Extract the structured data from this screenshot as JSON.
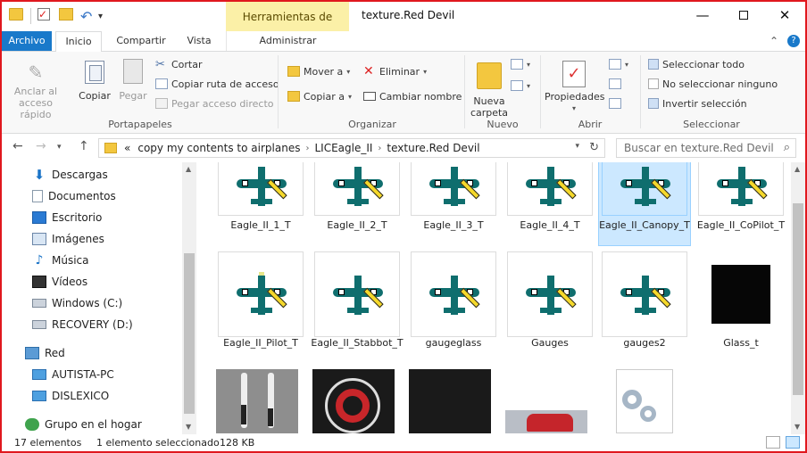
{
  "window": {
    "title": "texture.Red Devil",
    "context_tab": "Herramientas de imagen"
  },
  "tabs": {
    "archivo": "Archivo",
    "inicio": "Inicio",
    "compartir": "Compartir",
    "vista": "Vista",
    "administrar": "Administrar"
  },
  "ribbon": {
    "portapapeles": {
      "label": "Portapapeles",
      "anclar": "Anclar al acceso rápido",
      "copiar": "Copiar",
      "pegar": "Pegar",
      "cortar": "Cortar",
      "copiar_ruta": "Copiar ruta de acceso",
      "pegar_acceso": "Pegar acceso directo"
    },
    "organizar": {
      "label": "Organizar",
      "mover": "Mover a",
      "copiar_a": "Copiar a",
      "eliminar": "Eliminar",
      "cambiar_nombre": "Cambiar nombre"
    },
    "nuevo": {
      "label": "Nuevo",
      "nueva_carpeta": "Nueva carpeta"
    },
    "abrir": {
      "label": "Abrir",
      "propiedades": "Propiedades"
    },
    "seleccionar": {
      "label": "Seleccionar",
      "todo": "Seleccionar todo",
      "ninguno": "No seleccionar ninguno",
      "invertir": "Invertir selección"
    }
  },
  "address": {
    "prefix": "«",
    "crumbs": [
      "copy my contents to airplanes",
      "LICEagle_II",
      "texture.Red Devil"
    ],
    "search_placeholder": "Buscar en texture.Red Devil"
  },
  "navpane": {
    "items": [
      {
        "label": "Descargas",
        "icon": "download-icon"
      },
      {
        "label": "Documentos",
        "icon": "documents-icon"
      },
      {
        "label": "Escritorio",
        "icon": "desktop-icon"
      },
      {
        "label": "Imágenes",
        "icon": "pictures-icon"
      },
      {
        "label": "Música",
        "icon": "music-icon"
      },
      {
        "label": "Vídeos",
        "icon": "videos-icon"
      },
      {
        "label": "Windows (C:)",
        "icon": "drive-icon"
      },
      {
        "label": "RECOVERY (D:)",
        "icon": "drive-icon"
      },
      {
        "label": "Red",
        "icon": "network-icon"
      },
      {
        "label": "AUTISTA-PC",
        "icon": "computer-icon"
      },
      {
        "label": "DISLEXICO",
        "icon": "computer-icon"
      },
      {
        "label": "Grupo en el hogar",
        "icon": "homegroup-icon"
      }
    ]
  },
  "files": {
    "row1": [
      {
        "name": "Eagle_II_1_T"
      },
      {
        "name": "Eagle_II_2_T"
      },
      {
        "name": "Eagle_II_3_T"
      },
      {
        "name": "Eagle_II_4_T"
      },
      {
        "name": "Eagle_II_Canopy_T",
        "selected": true
      },
      {
        "name": "Eagle_II_CoPilot_T"
      }
    ],
    "row2": [
      {
        "name": "Eagle_II_Pilot_T"
      },
      {
        "name": "Eagle_II_Stabbot_T"
      },
      {
        "name": "gaugeglass"
      },
      {
        "name": "Gauges"
      },
      {
        "name": "gauges2"
      },
      {
        "name": "Glass_t"
      }
    ]
  },
  "status": {
    "count": "17 elementos",
    "selected": "1 elemento seleccionado",
    "size": "128 KB"
  },
  "colors": {
    "accent": "#1979ca",
    "selection": "#cce8ff",
    "context_tab": "#fbf0a7",
    "window_border": "#e0181e"
  }
}
